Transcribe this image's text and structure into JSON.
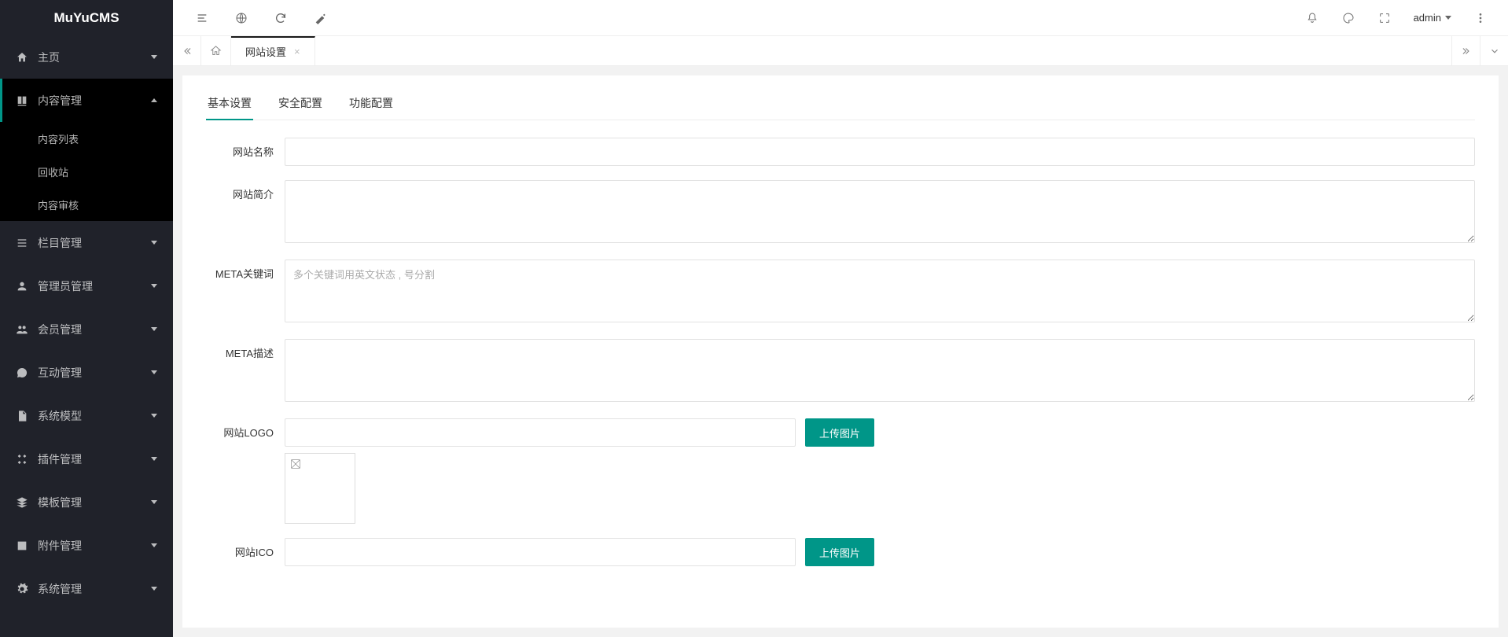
{
  "logo": "MuYuCMS",
  "sidebar": {
    "items": [
      {
        "label": "主页",
        "expandable": true
      },
      {
        "label": "内容管理",
        "expanded": true,
        "children": [
          "内容列表",
          "回收站",
          "内容审核"
        ]
      },
      {
        "label": "栏目管理"
      },
      {
        "label": "管理员管理"
      },
      {
        "label": "会员管理"
      },
      {
        "label": "互动管理"
      },
      {
        "label": "系统模型"
      },
      {
        "label": "插件管理"
      },
      {
        "label": "模板管理"
      },
      {
        "label": "附件管理"
      },
      {
        "label": "系统管理"
      }
    ]
  },
  "user": {
    "name": "admin"
  },
  "tabs": {
    "active": "网站设置"
  },
  "contentTabs": {
    "items": [
      "基本设置",
      "安全配置",
      "功能配置"
    ],
    "active": 0
  },
  "form": {
    "siteName": {
      "label": "网站名称",
      "value": ""
    },
    "siteDesc": {
      "label": "网站简介",
      "value": ""
    },
    "metaKeywords": {
      "label": "META关键词",
      "value": "",
      "placeholder": "多个关键词用英文状态 , 号分割"
    },
    "metaDesc": {
      "label": "META描述",
      "value": ""
    },
    "siteLogo": {
      "label": "网站LOGO",
      "value": "",
      "button": "上传图片"
    },
    "siteIco": {
      "label": "网站ICO",
      "value": "",
      "button": "上传图片"
    }
  }
}
